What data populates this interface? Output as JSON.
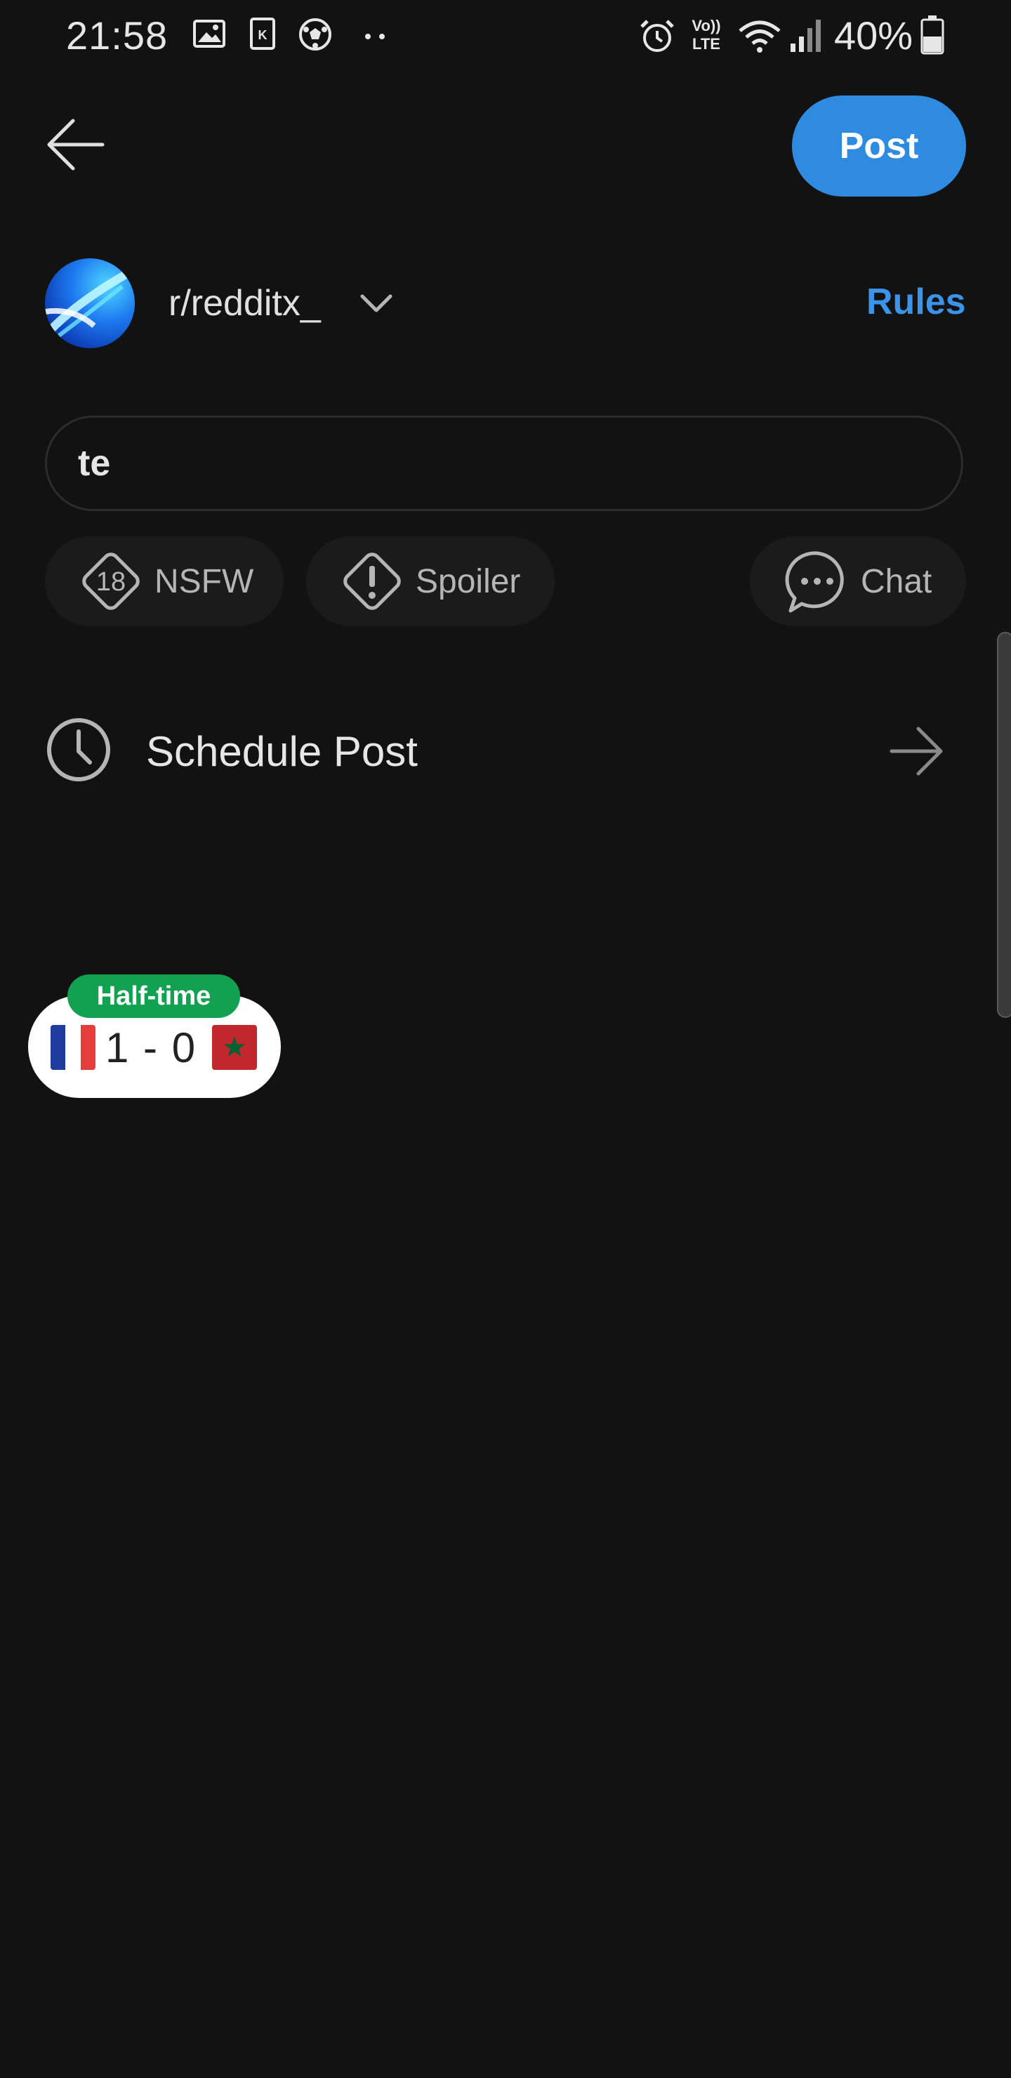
{
  "status_bar": {
    "time": "21:58",
    "battery_percent": "40%",
    "network_label": "LTE",
    "volte_label": "Vo))",
    "left_icons": [
      "gallery-icon",
      "sim-card-icon",
      "soccer-ball-icon",
      "more-dots-icon"
    ],
    "right_icons": [
      "alarm-icon",
      "volte-icon",
      "wifi-icon",
      "signal-icon",
      "battery-icon"
    ]
  },
  "header": {
    "back_icon": "back-arrow-icon",
    "post_label": "Post"
  },
  "community": {
    "name": "r/redditx_",
    "rules_label": "Rules"
  },
  "title_input": {
    "value": "te"
  },
  "tags": {
    "nsfw_label": "NSFW",
    "spoiler_label": "Spoiler",
    "chat_label": "Chat",
    "nsfw_badge": "18"
  },
  "schedule": {
    "label": "Schedule Post"
  },
  "score_widget": {
    "status": "Half-time",
    "score": "1 - 0",
    "home_flag": "france-flag-icon",
    "away_flag": "morocco-flag-icon",
    "away_flag_star": "★"
  },
  "colors": {
    "background": "#121212",
    "accent": "#2f8be0",
    "rules": "#3b94e8",
    "badge_green": "#12a150"
  }
}
